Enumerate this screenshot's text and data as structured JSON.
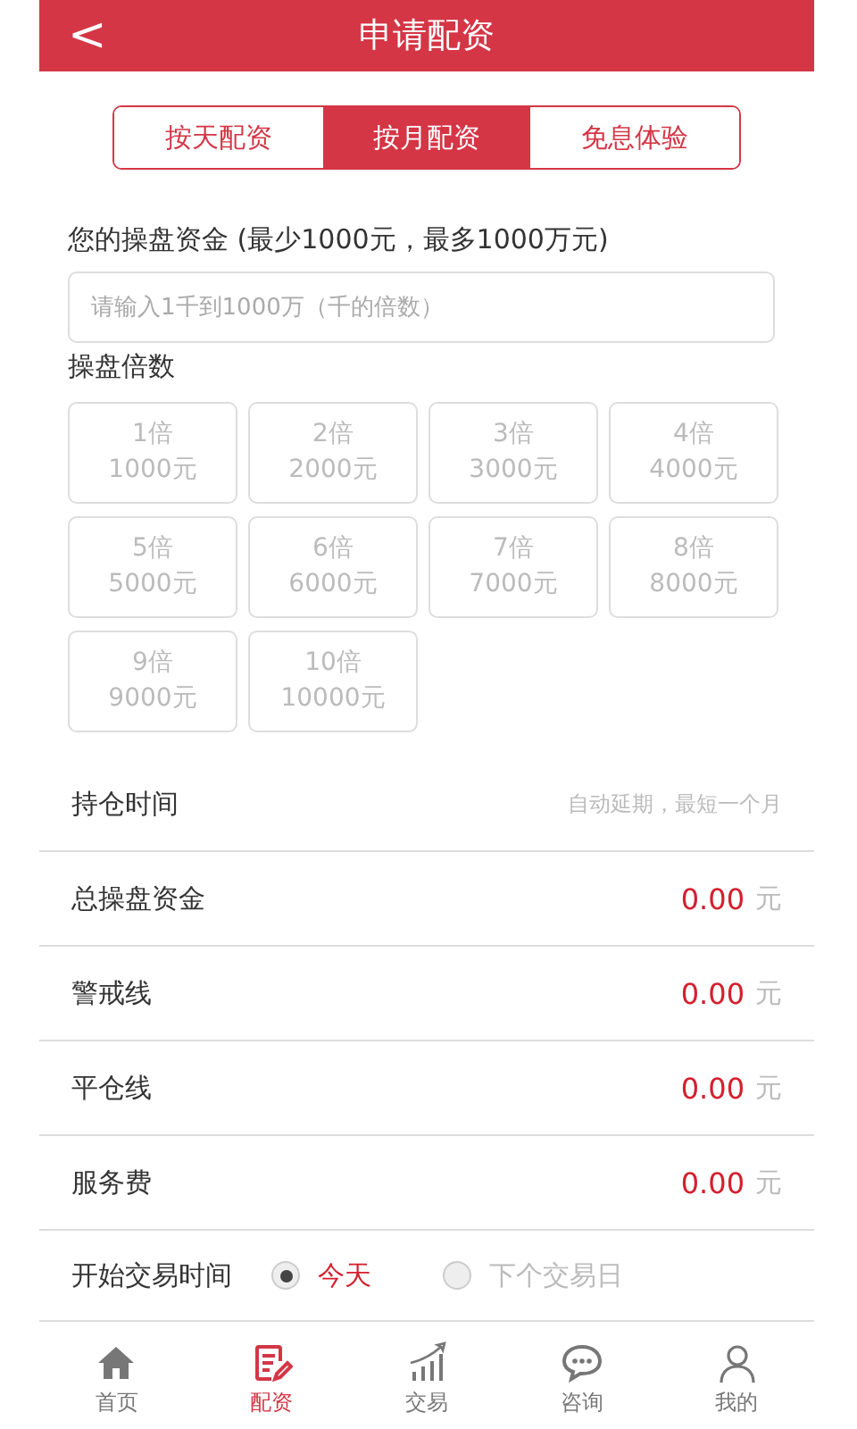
{
  "header": {
    "back": "<",
    "title": "申请配资"
  },
  "tabs": [
    {
      "label": "按天配资",
      "selected": false
    },
    {
      "label": "按月配资",
      "selected": true
    },
    {
      "label": "免息体验",
      "selected": false
    }
  ],
  "capital": {
    "label": "您的操盘资金 (最少1000元，最多1000万元)",
    "placeholder": "请输入1千到1000万（千的倍数）"
  },
  "multiplier": {
    "label": "操盘倍数",
    "options": [
      {
        "times": "1倍",
        "amount": "1000元",
        "selected": false
      },
      {
        "times": "2倍",
        "amount": "2000元",
        "selected": false
      },
      {
        "times": "3倍",
        "amount": "3000元",
        "selected": false
      },
      {
        "times": "4倍",
        "amount": "4000元",
        "selected": false
      },
      {
        "times": "5倍",
        "amount": "5000元",
        "selected": false
      },
      {
        "times": "6倍",
        "amount": "6000元",
        "selected": false
      },
      {
        "times": "7倍",
        "amount": "7000元",
        "selected": false
      },
      {
        "times": "8倍",
        "amount": "8000元",
        "selected": false
      },
      {
        "times": "9倍",
        "amount": "9000元",
        "selected": false
      },
      {
        "times": "10倍",
        "amount": "10000元",
        "selected": false
      }
    ]
  },
  "rows": [
    {
      "kind": "note",
      "label": "持仓时间",
      "value": "自动延期，最短一个月"
    },
    {
      "kind": "amount",
      "label": "总操盘资金",
      "value": "0.00",
      "unit": "元"
    },
    {
      "kind": "amount",
      "label": "警戒线",
      "value": "0.00",
      "unit": "元"
    },
    {
      "kind": "amount",
      "label": "平仓线",
      "value": "0.00",
      "unit": "元"
    },
    {
      "kind": "amount",
      "label": "服务费",
      "value": "0.00",
      "unit": "元"
    }
  ],
  "start_time": {
    "label": "开始交易时间",
    "options": [
      {
        "label": "今天",
        "selected": true
      },
      {
        "label": "下个交易日",
        "selected": false
      }
    ]
  },
  "bottom_nav": [
    {
      "kind": "home",
      "label": "首页",
      "selected": false
    },
    {
      "kind": "document",
      "label": "配资",
      "selected": true
    },
    {
      "kind": "chart",
      "label": "交易",
      "selected": false
    },
    {
      "kind": "chat",
      "label": "咨询",
      "selected": false
    },
    {
      "kind": "person",
      "label": "我的",
      "selected": false
    }
  ]
}
